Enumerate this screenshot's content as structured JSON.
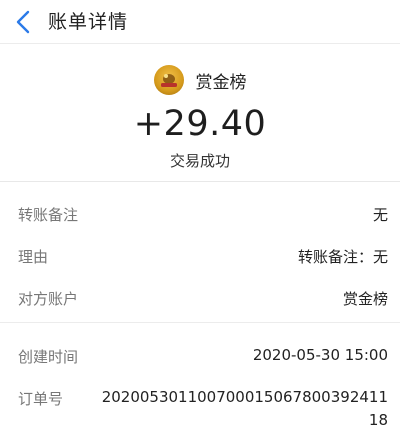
{
  "header": {
    "back_icon": "chevron-left-icon",
    "title": "账单详情",
    "accent": "#2b7ae8"
  },
  "summary": {
    "merchant_name": "赏金榜",
    "logo_text": "赏金榜",
    "amount": "+29.40",
    "status": "交易成功"
  },
  "details": [
    {
      "label": "转账备注",
      "value": "无"
    },
    {
      "label": "理由",
      "value": "转账备注：无"
    },
    {
      "label": "对方账户",
      "value": "赏金榜"
    }
  ],
  "details2": [
    {
      "label": "创建时间",
      "value": "2020-05-30 15:00"
    },
    {
      "label": "订单号",
      "value": "20200530110070001506780039241118"
    }
  ]
}
